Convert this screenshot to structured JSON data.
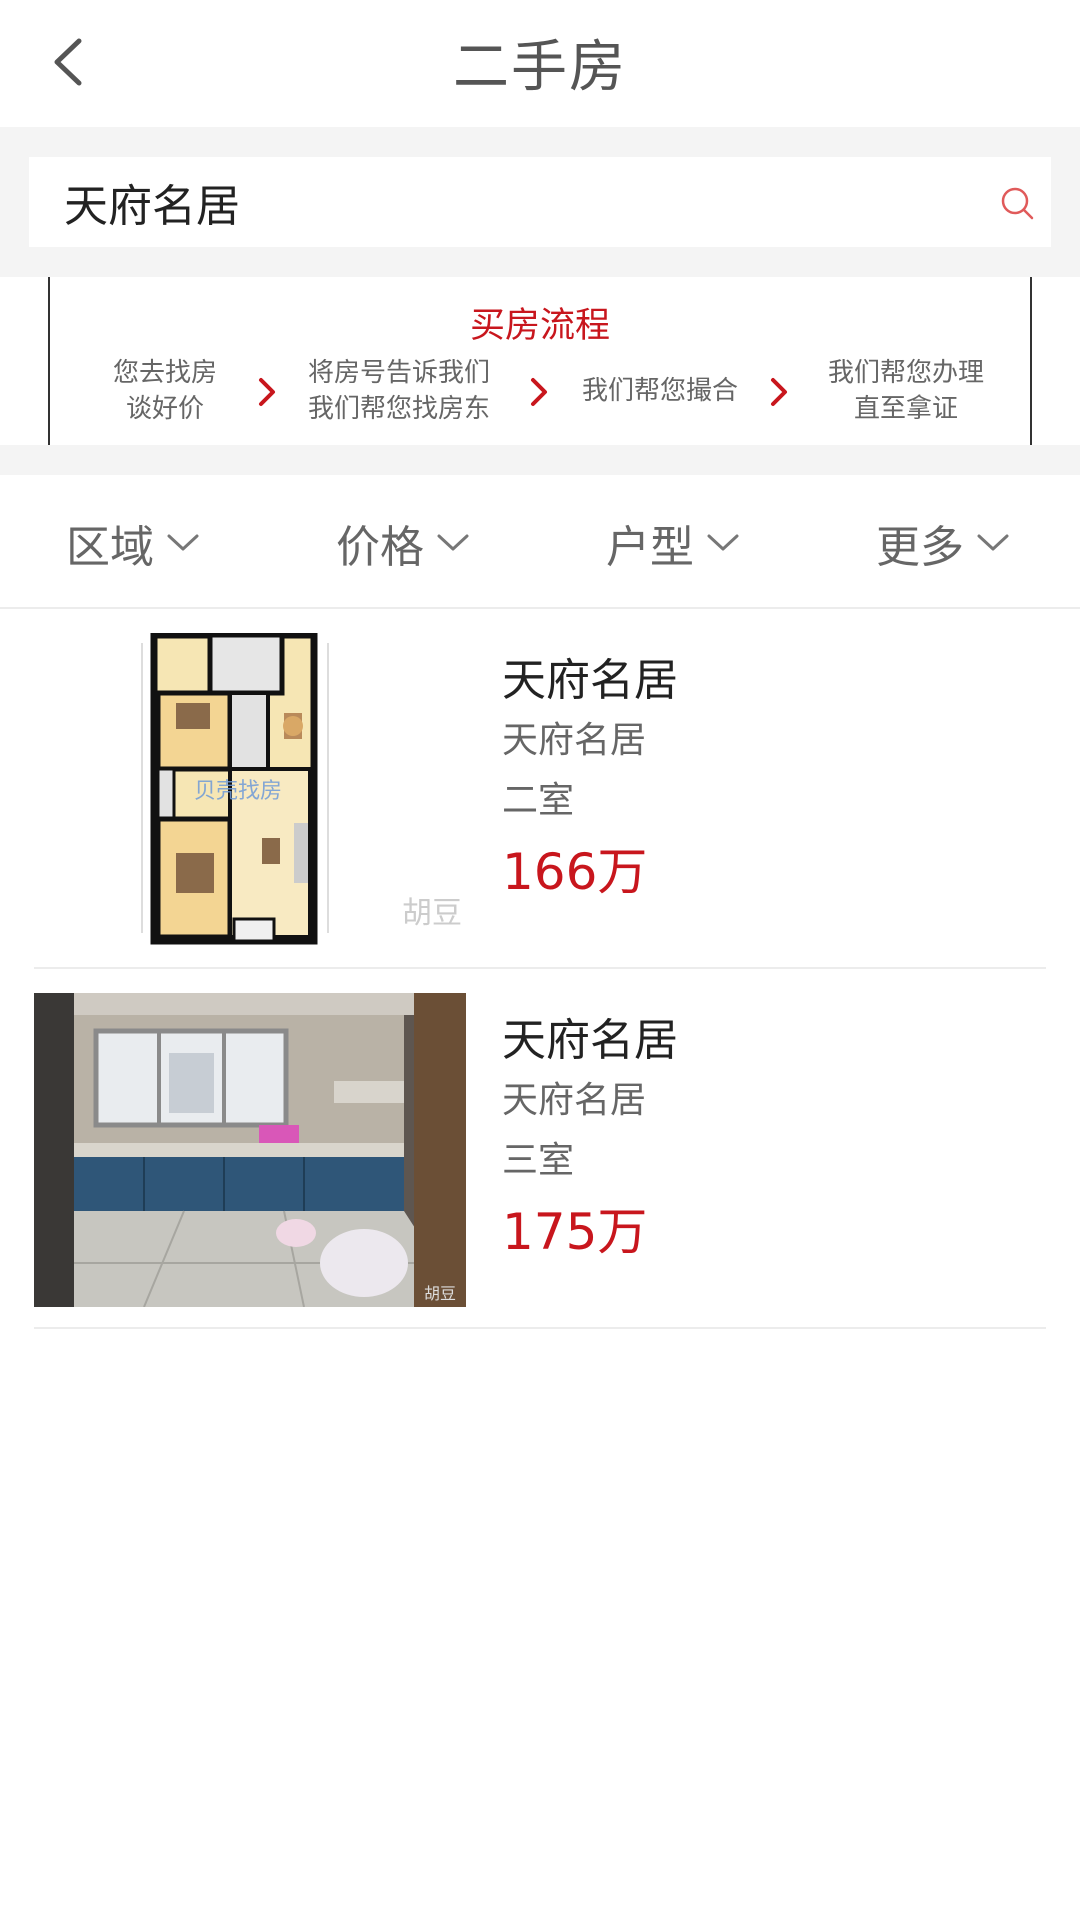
{
  "header": {
    "title": "二手房",
    "back_icon": "back-arrow-icon"
  },
  "search": {
    "value": "天府名居",
    "icon": "search-icon",
    "icon_color": "#e05a5a"
  },
  "process": {
    "title": "买房流程",
    "steps": [
      {
        "line1": "您去找房",
        "line2": "谈好价"
      },
      {
        "line1": "将房号告诉我们",
        "line2": "我们帮您找房东"
      },
      {
        "line1": "我们帮您撮合",
        "line2": ""
      },
      {
        "line1": "我们帮您办理",
        "line2": "直至拿证"
      }
    ],
    "arrow_color": "#c8161d"
  },
  "filters": [
    {
      "label": "区域"
    },
    {
      "label": "价格"
    },
    {
      "label": "户型"
    },
    {
      "label": "更多"
    }
  ],
  "listings": [
    {
      "title": "天府名居",
      "community": "天府名居",
      "layout": "二室",
      "price": "166万",
      "image": "floor-plan-image",
      "image_texts": {
        "watermark_logo": "贝壳找房",
        "watermark_site": "胡豆"
      }
    },
    {
      "title": "天府名居",
      "community": "天府名居",
      "layout": "三室",
      "price": "175万",
      "image": "kitchen-photo-image",
      "image_texts": {
        "watermark_site": "胡豆"
      }
    }
  ],
  "colors": {
    "accent": "#c8161d",
    "band_bg": "#f4f4f4",
    "divider": "#ececec"
  }
}
